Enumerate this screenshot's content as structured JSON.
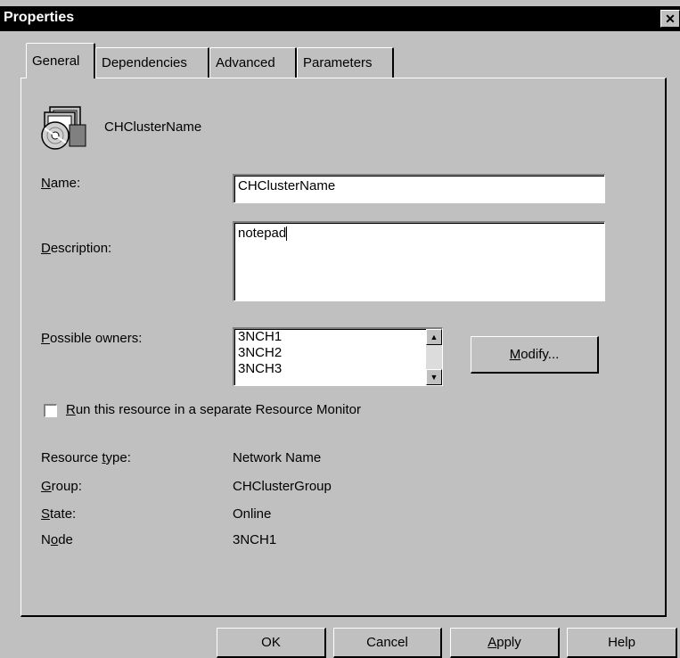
{
  "window": {
    "title": "Properties",
    "close_glyph": "✕"
  },
  "tabs": [
    {
      "label": "General",
      "active": true
    },
    {
      "label": "Dependencies",
      "active": false
    },
    {
      "label": "Advanced",
      "active": false
    },
    {
      "label": "Parameters",
      "active": false
    }
  ],
  "resource": {
    "name_display": "CHClusterName",
    "icon": "cluster-resource-icon"
  },
  "form": {
    "name_label_u": "N",
    "name_label_rest": "ame:",
    "name_value": "CHClusterName",
    "description_label_u": "D",
    "description_label_rest": "escription:",
    "description_value": "notepad",
    "owners_label_u": "P",
    "owners_label_rest": "ossible owners:",
    "owners": [
      "3NCH1",
      "3NCH2",
      "3NCH3"
    ],
    "modify_u": "M",
    "modify_rest": "odify...",
    "separate_monitor_u": "R",
    "separate_monitor_rest": "un this resource in a separate Resource Monitor",
    "separate_monitor_checked": false
  },
  "info": {
    "resource_type_label_a": "Resource ",
    "resource_type_label_u": "t",
    "resource_type_label_b": "ype:",
    "resource_type_value": "Network Name",
    "group_label_u": "G",
    "group_label_rest": "roup:",
    "group_value": "CHClusterGroup",
    "state_label_u": "S",
    "state_label_rest": "tate:",
    "state_value": "Online",
    "node_label_a": "N",
    "node_label_u": "o",
    "node_label_b": "de",
    "node_value": "3NCH1"
  },
  "buttons": {
    "ok": "OK",
    "cancel": "Cancel",
    "apply_u": "A",
    "apply_rest": "pply",
    "help": "Help"
  }
}
